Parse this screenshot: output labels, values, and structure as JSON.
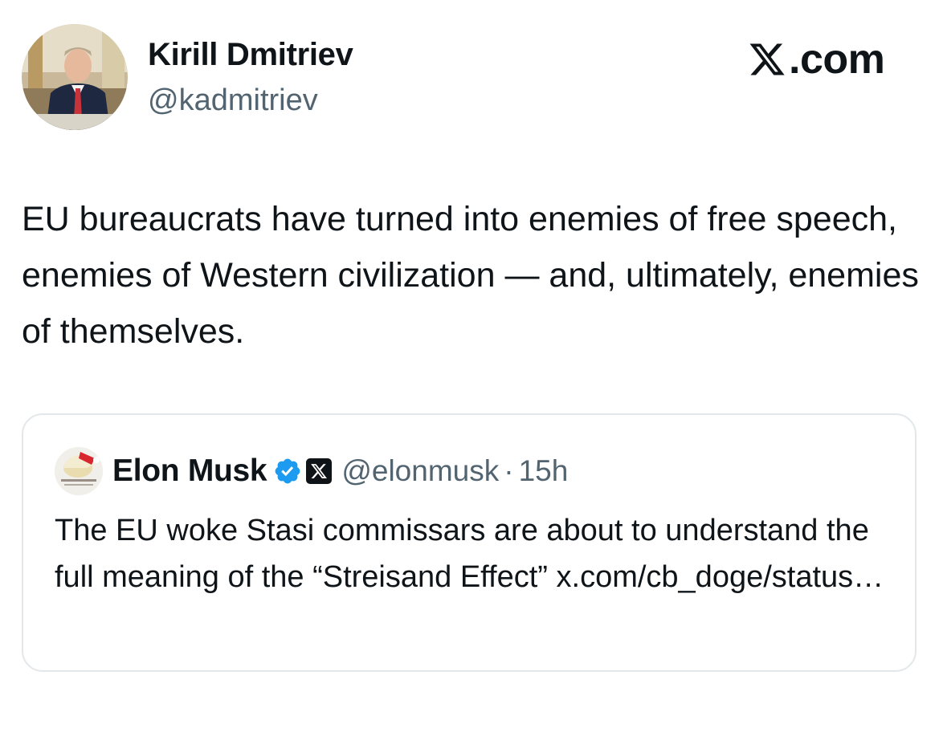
{
  "author": {
    "name": "Kirill Dmitriev",
    "handle": "@kadmitriev"
  },
  "brand": {
    "text": ".com",
    "icon": "x-logo-icon"
  },
  "tweet": {
    "text": "EU bureaucrats have turned into enemies of free speech, enemies of Western civilization — and, ultimately, enemies of themselves."
  },
  "quoted": {
    "name": "Elon Musk",
    "handle": "@elonmusk",
    "separator": "·",
    "time": "15h",
    "text": "The EU woke Stasi commissars are about to understand the full meaning of the “Streisand Effect” x.com/cb_doge/status…",
    "verified_color": "#1d9bf0"
  },
  "colors": {
    "text": "#0f1419",
    "secondary": "#536471",
    "border": "#e3e7ea",
    "verified": "#1d9bf0"
  }
}
